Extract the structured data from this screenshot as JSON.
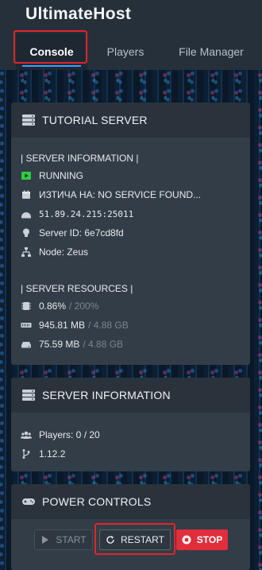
{
  "app": {
    "title": "UltimateHost"
  },
  "tabs": [
    {
      "label": "Console",
      "active": true
    },
    {
      "label": "Players",
      "active": false
    },
    {
      "label": "File Manager",
      "active": false
    }
  ],
  "tutorial_card": {
    "title": "TUTORIAL SERVER",
    "server_info_label": "| SERVER INFORMATION |",
    "status": "RUNNING",
    "expires": "ИЗТИЧА НА: NO SERVICE FOUND...",
    "address": "51.89.24.215:25011",
    "server_id": "Server ID: 6e7cd8fd",
    "node": "Node: Zeus",
    "resources_label": "| SERVER RESOURCES |",
    "cpu": {
      "value": "0.86%",
      "limit": "/ 200%"
    },
    "memory": {
      "value": "945.81 MB",
      "limit": "/ 4.88 GB"
    },
    "disk": {
      "value": "75.59 MB",
      "limit": "/ 4.88 GB"
    }
  },
  "server_info_card": {
    "title": "SERVER INFORMATION",
    "players": "Players: 0 / 20",
    "version": "1.12.2"
  },
  "power_card": {
    "title": "POWER CONTROLS",
    "start_label": "START",
    "restart_label": "RESTART",
    "stop_label": "STOP"
  },
  "colors": {
    "accent_highlight": "#e0252b",
    "running": "#2ecc40",
    "stop": "#e02e3a"
  }
}
